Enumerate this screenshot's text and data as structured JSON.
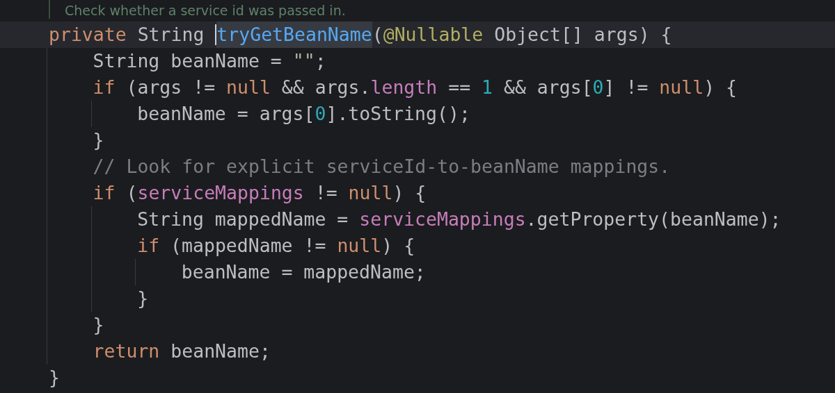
{
  "doc_comment": {
    "text": "Check whether a service id was passed in."
  },
  "lines": [
    {
      "current": true,
      "tokens": [
        {
          "kind": "keyword",
          "text": "private"
        },
        {
          "kind": "plain",
          "text": " String "
        },
        {
          "kind": "method",
          "text": "tryGetBeanName",
          "selected": true
        },
        {
          "kind": "plain",
          "text": "("
        },
        {
          "kind": "annotation",
          "text": "@Nullable"
        },
        {
          "kind": "plain",
          "text": " Object[] args) {"
        }
      ],
      "children": [
        {
          "current": false,
          "tokens": [
            {
              "kind": "plain",
              "text": "String beanName = "
            },
            {
              "kind": "string",
              "text": "\"\""
            },
            {
              "kind": "plain",
              "text": ";"
            }
          ]
        },
        {
          "current": false,
          "tokens": [
            {
              "kind": "keyword",
              "text": "if"
            },
            {
              "kind": "plain",
              "text": " (args != "
            },
            {
              "kind": "keyword",
              "text": "null"
            },
            {
              "kind": "plain",
              "text": " && args."
            },
            {
              "kind": "field",
              "text": "length"
            },
            {
              "kind": "plain",
              "text": " == "
            },
            {
              "kind": "number",
              "text": "1"
            },
            {
              "kind": "plain",
              "text": " && args["
            },
            {
              "kind": "number",
              "text": "0"
            },
            {
              "kind": "plain",
              "text": "] != "
            },
            {
              "kind": "keyword",
              "text": "null"
            },
            {
              "kind": "plain",
              "text": ") {"
            }
          ],
          "children": [
            {
              "current": false,
              "tokens": [
                {
                  "kind": "plain",
                  "text": "beanName = args["
                },
                {
                  "kind": "number",
                  "text": "0"
                },
                {
                  "kind": "plain",
                  "text": "].toString();"
                }
              ]
            }
          ]
        },
        {
          "current": false,
          "tokens": [
            {
              "kind": "plain",
              "text": "}"
            }
          ]
        },
        {
          "current": false,
          "tokens": [
            {
              "kind": "comment",
              "text": "// Look for explicit serviceId-to-beanName mappings."
            }
          ]
        },
        {
          "current": false,
          "tokens": [
            {
              "kind": "keyword",
              "text": "if"
            },
            {
              "kind": "plain",
              "text": " ("
            },
            {
              "kind": "field",
              "text": "serviceMappings"
            },
            {
              "kind": "plain",
              "text": " != "
            },
            {
              "kind": "keyword",
              "text": "null"
            },
            {
              "kind": "plain",
              "text": ") {"
            }
          ],
          "children": [
            {
              "current": false,
              "tokens": [
                {
                  "kind": "plain",
                  "text": "String mappedName = "
                },
                {
                  "kind": "field",
                  "text": "serviceMappings"
                },
                {
                  "kind": "plain",
                  "text": ".getProperty(beanName);"
                }
              ]
            },
            {
              "current": false,
              "tokens": [
                {
                  "kind": "keyword",
                  "text": "if"
                },
                {
                  "kind": "plain",
                  "text": " (mappedName != "
                },
                {
                  "kind": "keyword",
                  "text": "null"
                },
                {
                  "kind": "plain",
                  "text": ") {"
                }
              ],
              "children": [
                {
                  "current": false,
                  "tokens": [
                    {
                      "kind": "plain",
                      "text": "beanName = mappedName;"
                    }
                  ]
                }
              ]
            },
            {
              "current": false,
              "tokens": [
                {
                  "kind": "plain",
                  "text": "}"
                }
              ]
            }
          ]
        },
        {
          "current": false,
          "tokens": [
            {
              "kind": "plain",
              "text": "}"
            }
          ]
        },
        {
          "current": false,
          "tokens": [
            {
              "kind": "keyword",
              "text": "return"
            },
            {
              "kind": "plain",
              "text": " beanName;"
            }
          ]
        }
      ]
    },
    {
      "current": false,
      "tokens": [
        {
          "kind": "plain",
          "text": "}"
        }
      ]
    }
  ]
}
